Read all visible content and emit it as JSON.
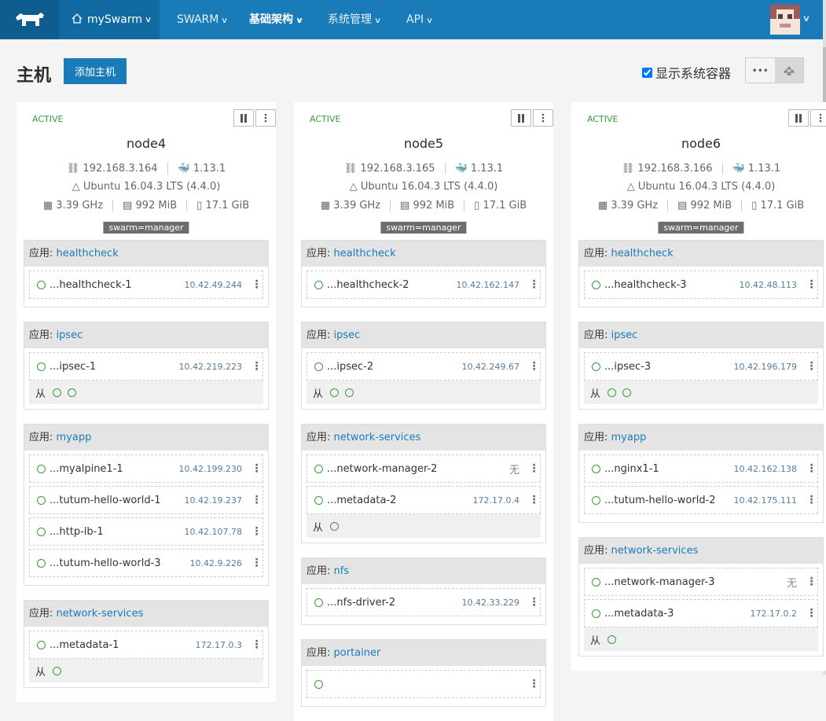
{
  "nav": {
    "environment": "mySwarm",
    "items": [
      "SWARM",
      "基础架构",
      "系统管理",
      "API"
    ]
  },
  "page": {
    "title": "主机",
    "add_host_label": "添加主机",
    "show_system_label": "显示系统容器",
    "show_system_checked": true
  },
  "labels": {
    "stack_prefix": "应用: ",
    "sidekick": "从"
  },
  "hosts": [
    {
      "state": "ACTIVE",
      "name": "node4",
      "ip": "192.168.3.164",
      "docker": "1.13.1",
      "os": "Ubuntu 16.04.3 LTS (4.4.0)",
      "cpu": "3.39 GHz",
      "mem": "992 MiB",
      "disk": "17.1 GiB",
      "label": "swarm=manager",
      "stacks": [
        {
          "name": "healthcheck",
          "containers": [
            {
              "name": "...healthcheck-1",
              "ip": "10.42.49.244"
            }
          ]
        },
        {
          "name": "ipsec",
          "containers": [
            {
              "name": "...ipsec-1",
              "ip": "10.42.219.223"
            }
          ],
          "sidekicks": 2
        },
        {
          "name": "myapp",
          "containers": [
            {
              "name": "...myalpine1-1",
              "ip": "10.42.199.230"
            },
            {
              "name": "...tutum-hello-world-1",
              "ip": "10.42.19.237"
            },
            {
              "name": "...http-lb-1",
              "ip": "10.42.107.78"
            },
            {
              "name": "...tutum-hello-world-3",
              "ip": "10.42.9.226"
            }
          ]
        },
        {
          "name": "network-services",
          "containers": [
            {
              "name": "...metadata-1",
              "ip": "172.17.0.3"
            }
          ],
          "sidekicks": 1
        }
      ]
    },
    {
      "state": "ACTIVE",
      "name": "node5",
      "ip": "192.168.3.165",
      "docker": "1.13.1",
      "os": "Ubuntu 16.04.3 LTS (4.4.0)",
      "cpu": "3.39 GHz",
      "mem": "992 MiB",
      "disk": "17.1 GiB",
      "label": "swarm=manager",
      "stacks": [
        {
          "name": "healthcheck",
          "containers": [
            {
              "name": "...healthcheck-2",
              "ip": "10.42.162.147"
            }
          ]
        },
        {
          "name": "ipsec",
          "containers": [
            {
              "name": "...ipsec-2",
              "ip": "10.42.249.67"
            }
          ],
          "sidekicks": 2
        },
        {
          "name": "network-services",
          "containers": [
            {
              "name": "...network-manager-2",
              "ip": "无"
            },
            {
              "name": "...metadata-2",
              "ip": "172.17.0.4"
            }
          ],
          "sidekicks": 1
        },
        {
          "name": "nfs",
          "containers": [
            {
              "name": "...nfs-driver-2",
              "ip": "10.42.33.229"
            }
          ]
        },
        {
          "name": "portainer",
          "containers": [
            {
              "name": "",
              "ip": ""
            }
          ]
        }
      ]
    },
    {
      "state": "ACTIVE",
      "name": "node6",
      "ip": "192.168.3.166",
      "docker": "1.13.1",
      "os": "Ubuntu 16.04.3 LTS (4.4.0)",
      "cpu": "3.39 GHz",
      "mem": "992 MiB",
      "disk": "17.1 GiB",
      "label": "swarm=manager",
      "stacks": [
        {
          "name": "healthcheck",
          "containers": [
            {
              "name": "...healthcheck-3",
              "ip": "10.42.48.113"
            }
          ]
        },
        {
          "name": "ipsec",
          "containers": [
            {
              "name": "...ipsec-3",
              "ip": "10.42.196.179"
            }
          ],
          "sidekicks": 2
        },
        {
          "name": "myapp",
          "containers": [
            {
              "name": "...nginx1-1",
              "ip": "10.42.162.138"
            },
            {
              "name": "...tutum-hello-world-2",
              "ip": "10.42.175.111"
            }
          ]
        },
        {
          "name": "network-services",
          "containers": [
            {
              "name": "...network-manager-3",
              "ip": "无"
            },
            {
              "name": "...metadata-3",
              "ip": "172.17.0.2"
            }
          ],
          "sidekicks": 1
        }
      ]
    }
  ]
}
